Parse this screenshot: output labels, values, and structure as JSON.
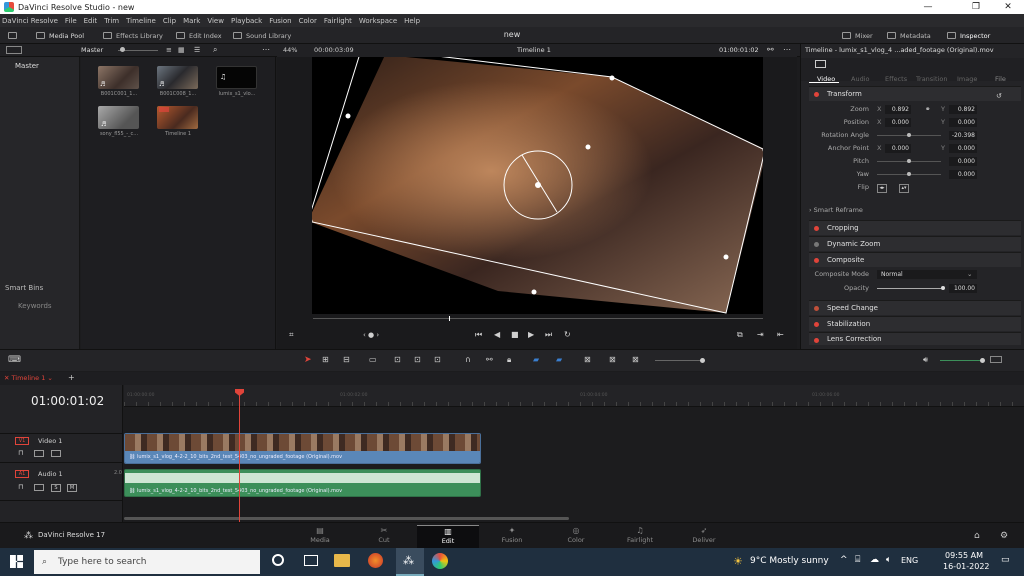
{
  "window": {
    "title": "DaVinci Resolve Studio - new",
    "minimize": "—",
    "maximize": "❐",
    "close": "✕"
  },
  "menu": [
    "DaVinci Resolve",
    "File",
    "Edit",
    "Trim",
    "Timeline",
    "Clip",
    "Mark",
    "View",
    "Playback",
    "Fusion",
    "Color",
    "Fairlight",
    "Workspace",
    "Help"
  ],
  "toolbar": {
    "media_pool": "Media Pool",
    "effects_library": "Effects Library",
    "edit_index": "Edit Index",
    "sound_library": "Sound Library",
    "project": "new",
    "mixer": "Mixer",
    "metadata": "Metadata",
    "inspector": "Inspector"
  },
  "media_pool": {
    "bin_label": "Master",
    "bins": [
      "Master"
    ],
    "smart_bins": "Smart Bins",
    "keywords": "Keywords",
    "clips": [
      "B001C001_1...",
      "B001C008_1...",
      "lumix_s1_vlo...",
      "sony_fl55_-_c...",
      "Timeline 1"
    ]
  },
  "viewer": {
    "zoom": "44%",
    "source_tc": "00:00:03:09",
    "timeline_name": "Timeline 1",
    "record_tc": "01:00:01:02"
  },
  "inspector": {
    "clip_title": "Timeline - lumix_s1_vlog_4 ...aded_footage (Original).mov",
    "tabs": [
      "Video",
      "Audio",
      "Effects",
      "Transition",
      "Image",
      "File"
    ],
    "transform": "Transform",
    "zoom_label": "Zoom",
    "zoom_x": "0.892",
    "zoom_y": "0.892",
    "position_label": "Position",
    "pos_x": "0.000",
    "pos_y": "0.000",
    "rotation_label": "Rotation Angle",
    "rotation": "-20.398",
    "anchor_label": "Anchor Point",
    "anchor_x": "0.000",
    "anchor_y": "0.000",
    "pitch_label": "Pitch",
    "pitch": "0.000",
    "yaw_label": "Yaw",
    "yaw": "0.000",
    "flip_label": "Flip",
    "x_letter": "X",
    "y_letter": "Y",
    "smart_reframe": "Smart Reframe",
    "cropping": "Cropping",
    "dynamic_zoom": "Dynamic Zoom",
    "composite": "Composite",
    "composite_mode_label": "Composite Mode",
    "composite_mode": "Normal",
    "opacity_label": "Opacity",
    "opacity": "100.00",
    "speed_change": "Speed Change",
    "stabilization": "Stabilization",
    "lens_correction": "Lens Correction"
  },
  "timeline": {
    "tab": "Timeline 1",
    "timecode": "01:00:01:02",
    "ruler_marks": [
      "01:00:00:00",
      "01:00:02:00",
      "01:00:04:00",
      "01:00:06:00"
    ],
    "v1_badge": "V1",
    "v1_name": "Video 1",
    "a1_badge": "A1",
    "a1_name": "Audio 1",
    "a1_channels": "2.0",
    "video_clip": "lumix_s1_vlog_4-2-2_10_bits_2nd_test_5403_no_ungraded_footage (Original).mov",
    "audio_clip": "lumix_s1_vlog_4-2-2_10_bits_2nd_test_5403_no_ungraded_footage (Original).mov",
    "solo": "S",
    "mute": "M"
  },
  "pages": [
    "Media",
    "Cut",
    "Edit",
    "Fusion",
    "Color",
    "Fairlight",
    "Deliver"
  ],
  "active_page": "Edit",
  "brand": "DaVinci Resolve 17",
  "taskbar": {
    "search_placeholder": "Type here to search",
    "weather": "9°C  Mostly sunny",
    "lang": "ENG",
    "time": "09:55 AM",
    "date": "16-01-2022"
  },
  "colors": {
    "accent_red": "#e0443a",
    "video_clip": "#5a87b8",
    "audio_clip": "#3c8f5a",
    "playhead": "#e0443a"
  }
}
